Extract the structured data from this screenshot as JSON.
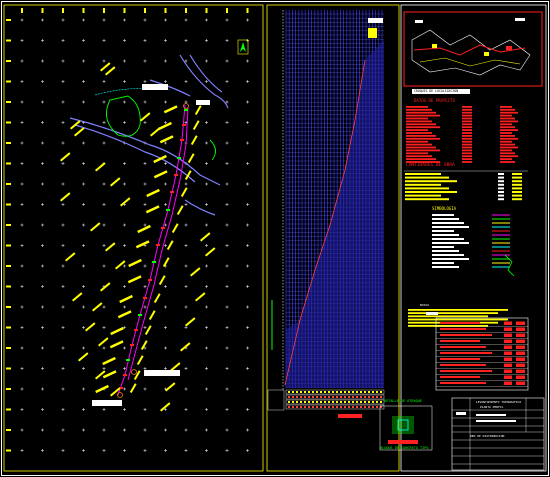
{
  "sheet": {
    "location_title": "CROQUIS DE LOCALIZACION",
    "project_data_title": "DATOS DE PROYECTO",
    "quantities_title": "CANTIDADES DE OBRA",
    "symbology_title": "SIMBOLOGIA",
    "notes_title": "NOTAS",
    "detail_title": "DETALLE DE ATRAQUE",
    "block_title": "BLOQUE DE CONCRETO TIPO",
    "titleblock_line1": "LEVANTAMIENTO TOPOGRAFICO",
    "titleblock_line2": "PLANTA PERFIL",
    "titleblock_line3": "RED DE DISTRIBUCION"
  },
  "colors": {
    "background": "#000000",
    "frame": "#ffffff",
    "grid_cross": "#ffffff",
    "annotation": "#ffff00",
    "highlight": "#ff0000",
    "pipeline": "#ff00ff",
    "road": "#8080ff",
    "vegetation": "#00ff00",
    "water": "#00ffff"
  }
}
